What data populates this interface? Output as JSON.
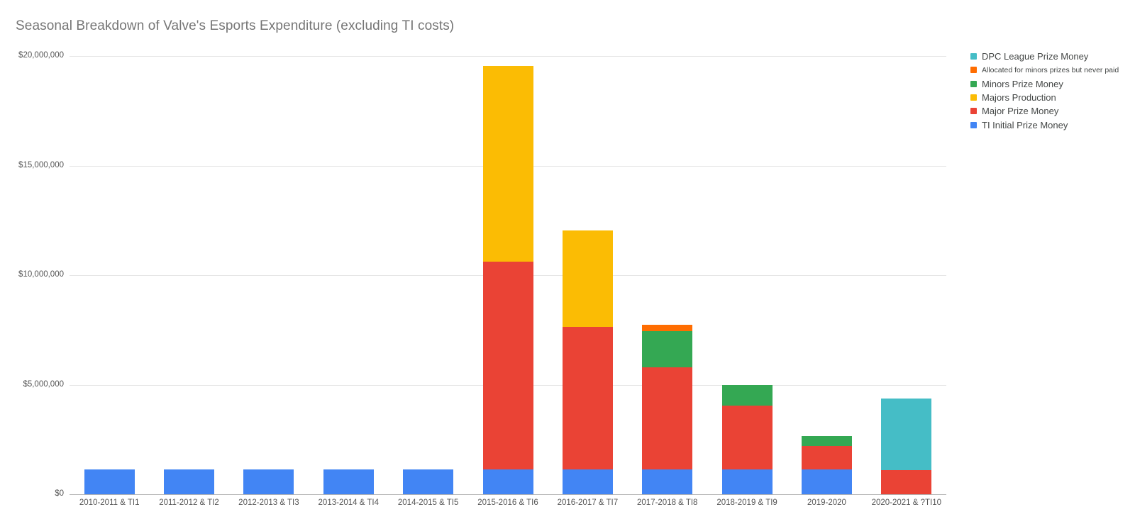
{
  "chart_data": {
    "type": "bar",
    "stacked": true,
    "title": "Seasonal Breakdown of Valve's Esports Expenditure (excluding TI costs)",
    "xlabel": "",
    "ylabel": "",
    "ylim": [
      0,
      20000000
    ],
    "grid": true,
    "legend_position": "right",
    "y_ticks": [
      {
        "value": 0,
        "label": "$0"
      },
      {
        "value": 5000000,
        "label": "$5,000,000"
      },
      {
        "value": 10000000,
        "label": "$10,000,000"
      },
      {
        "value": 15000000,
        "label": "$15,000,000"
      },
      {
        "value": 20000000,
        "label": "$20,000,000"
      }
    ],
    "categories": [
      "2010-2011 & TI1",
      "2011-2012 & TI2",
      "2012-2013 & TI3",
      "2013-2014 & TI4",
      "2014-2015 & TI5",
      "2015-2016 & TI6",
      "2016-2017 & TI7",
      "2017-2018 & TI8",
      "2018-2019 & TI9",
      "2019-2020",
      "2020-2021 & ?TI10"
    ],
    "series": [
      {
        "name": "TI Initial Prize Money",
        "color": "#4285f4",
        "values": [
          1130000,
          1130000,
          1130000,
          1130000,
          1130000,
          1130000,
          1130000,
          1130000,
          1130000,
          1130000,
          0
        ]
      },
      {
        "name": "Major Prize Money",
        "color": "#ea4335",
        "values": [
          0,
          0,
          0,
          0,
          0,
          9470000,
          6520000,
          4660000,
          2900000,
          1060000,
          1100000
        ]
      },
      {
        "name": "Majors Production",
        "color": "#fbbc04",
        "values": [
          0,
          0,
          0,
          0,
          0,
          8950000,
          4400000,
          0,
          0,
          0,
          0
        ]
      },
      {
        "name": "Minors Prize Money",
        "color": "#34a853",
        "values": [
          0,
          0,
          0,
          0,
          0,
          0,
          0,
          1650000,
          960000,
          480000,
          0
        ]
      },
      {
        "name": "Allocated for minors prizes but never paid",
        "color": "#ff6d01",
        "values": [
          0,
          0,
          0,
          0,
          0,
          0,
          0,
          300000,
          0,
          0,
          0
        ]
      },
      {
        "name": "DPC League Prize Money",
        "color": "#45bdc6",
        "values": [
          0,
          0,
          0,
          0,
          0,
          0,
          0,
          0,
          0,
          0,
          3280000
        ]
      }
    ]
  },
  "legend": {
    "items": [
      {
        "label": "DPC League Prize Money",
        "color": "#45bdc6",
        "small": false
      },
      {
        "label": "Allocated for minors prizes but never paid",
        "color": "#ff6d01",
        "small": true
      },
      {
        "label": "Minors Prize Money",
        "color": "#34a853",
        "small": false
      },
      {
        "label": "Majors Production",
        "color": "#fbbc04",
        "small": false
      },
      {
        "label": "Major Prize Money",
        "color": "#ea4335",
        "small": false
      },
      {
        "label": "TI Initial Prize Money",
        "color": "#4285f4",
        "small": false
      }
    ]
  }
}
